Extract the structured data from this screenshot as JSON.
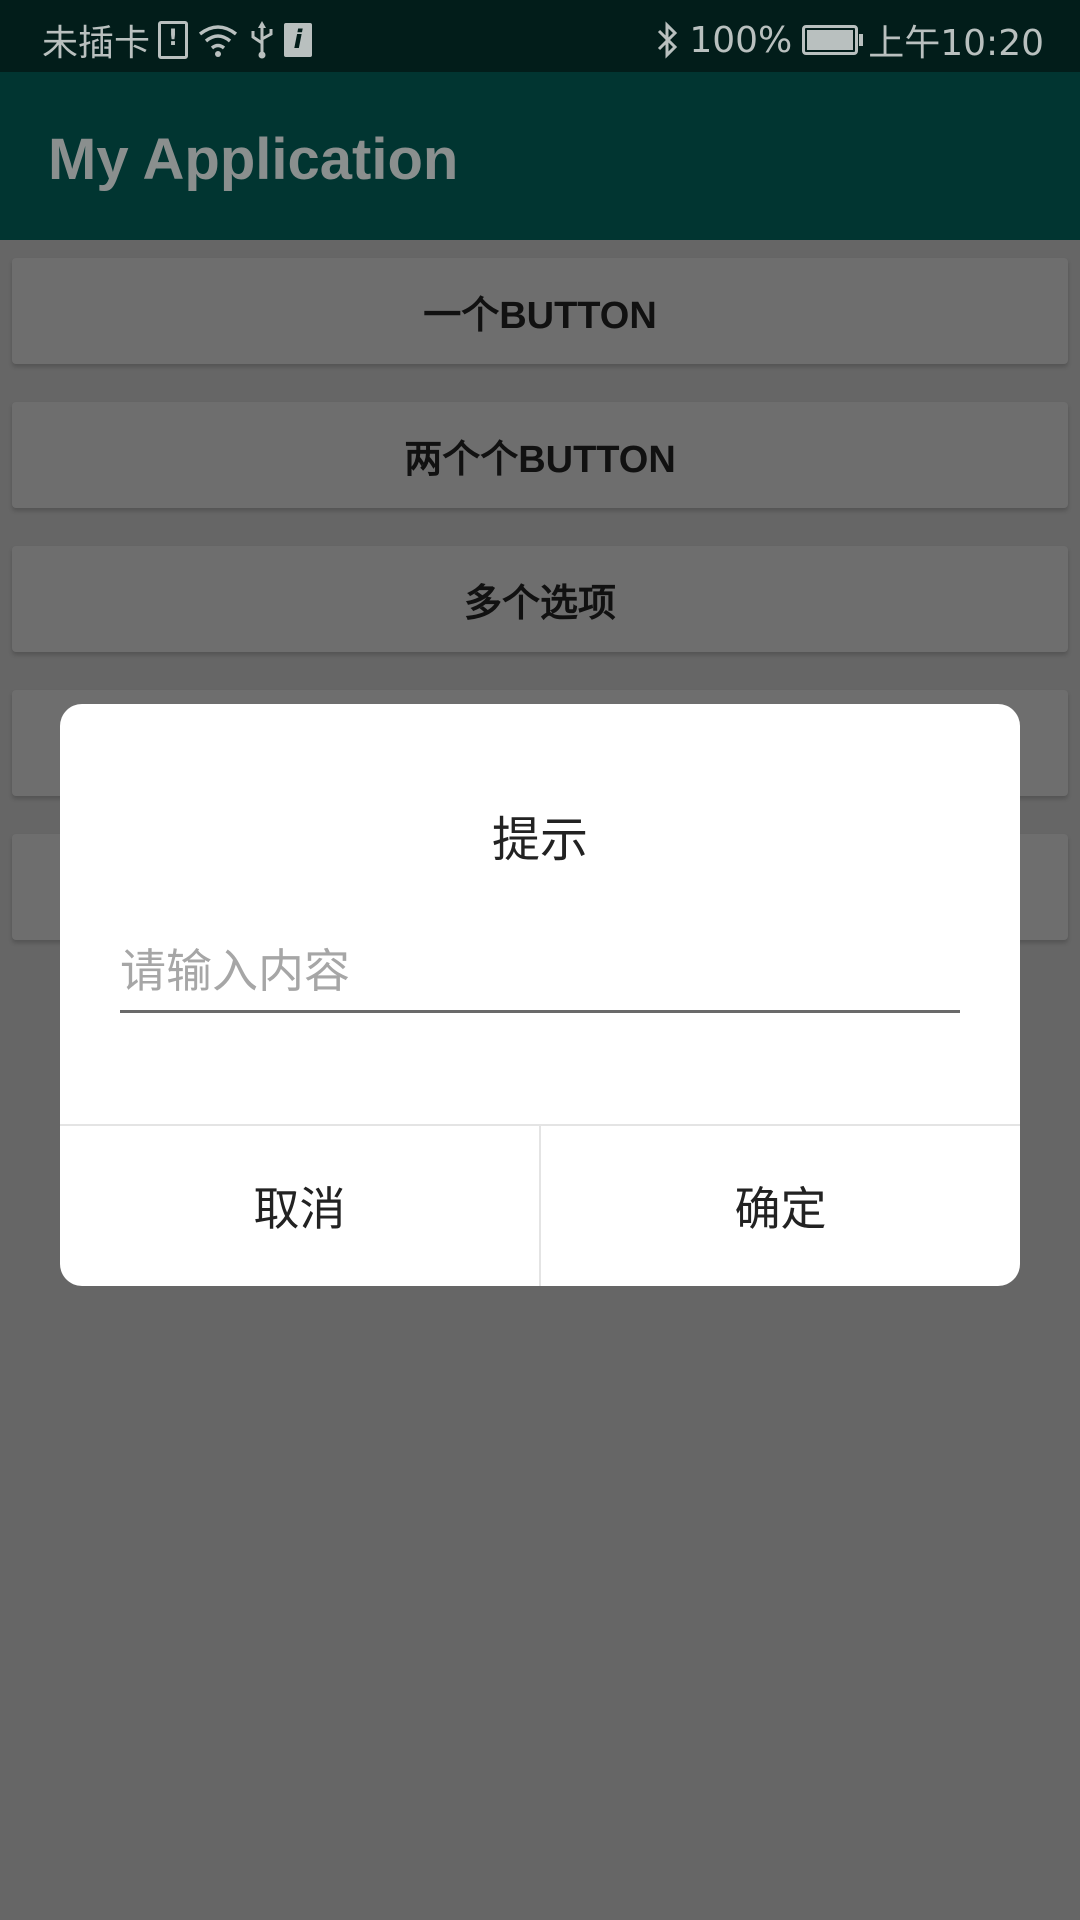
{
  "status_bar": {
    "carrier": "未插卡",
    "battery_percent": "100%",
    "battery_level": 1.0,
    "time": "上午10:20"
  },
  "app_bar": {
    "title": "My Application"
  },
  "buttons": [
    {
      "label": "一个BUTTON"
    },
    {
      "label": "两个个BUTTON"
    },
    {
      "label": "多个选项"
    },
    {
      "label": ""
    },
    {
      "label": ""
    }
  ],
  "dialog": {
    "title": "提示",
    "input_placeholder": "请输入内容",
    "input_value": "",
    "cancel_label": "取消",
    "confirm_label": "确定"
  },
  "colors": {
    "status_bar_bg": "#021d1a",
    "app_bar_bg": "#013531",
    "scrim_bg": "#666666",
    "dialog_bg": "#ffffff"
  }
}
